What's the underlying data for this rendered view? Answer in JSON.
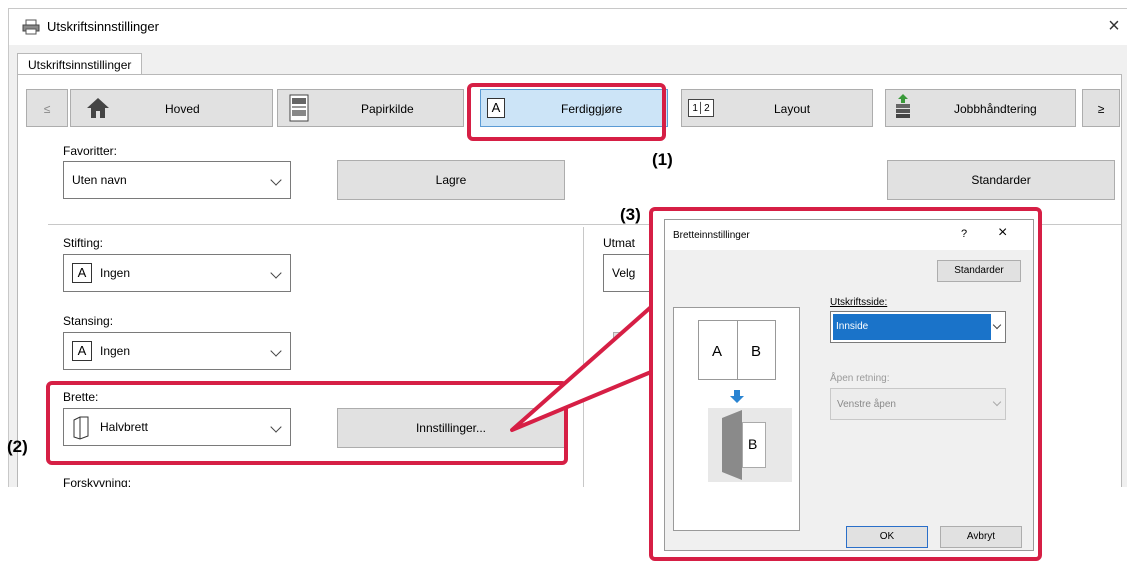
{
  "window": {
    "title": "Utskriftsinnstillinger",
    "close_glyph": "×",
    "tab_label": "Utskriftsinnstillinger"
  },
  "toolbar": {
    "prev_label": "≤",
    "next_label": "≥",
    "tabs": [
      {
        "label": "Hoved",
        "icon": "home-icon"
      },
      {
        "label": "Papirkilde",
        "icon": "paper-source-icon"
      },
      {
        "label": "Ferdiggjøre",
        "icon": "finishing-icon",
        "selected": true
      },
      {
        "label": "Layout",
        "icon": "layout-icon"
      },
      {
        "label": "Jobbhåndtering",
        "icon": "job-handling-icon"
      }
    ],
    "layout_icon_text": "1│2"
  },
  "favorites": {
    "label": "Favoritter:",
    "value": "Uten navn",
    "save_label": "Lagre",
    "defaults_label": "Standarder"
  },
  "stapling": {
    "label": "Stifting:",
    "value": "Ingen"
  },
  "punching": {
    "label": "Stansing:",
    "value": "Ingen"
  },
  "fold": {
    "label": "Brette:",
    "value": "Halvbrett",
    "settings_label": "Innstillinger..."
  },
  "offset": {
    "label": "Forskyvning:"
  },
  "output": {
    "label": "Utmat",
    "value": "Velg"
  },
  "icon_letter_a": "A",
  "callouts": {
    "c1": "(1)",
    "c2": "(2)",
    "c3": "(3)"
  },
  "dialog": {
    "title": "Bretteinnstillinger",
    "help_glyph": "?",
    "close_glyph": "×",
    "defaults_label": "Standarder",
    "print_side_label": "Utskriftsside:",
    "print_side_value": "Innside",
    "open_direction_label": "Åpen retning:",
    "open_direction_value": "Venstre åpen",
    "preview_letters": [
      "A",
      "B"
    ],
    "ok_label": "OK",
    "cancel_label": "Avbryt"
  },
  "colors": {
    "accent_red": "#d61f45",
    "selected_tab": "#cce4f7",
    "dropdown_selected": "#1a73c9"
  }
}
